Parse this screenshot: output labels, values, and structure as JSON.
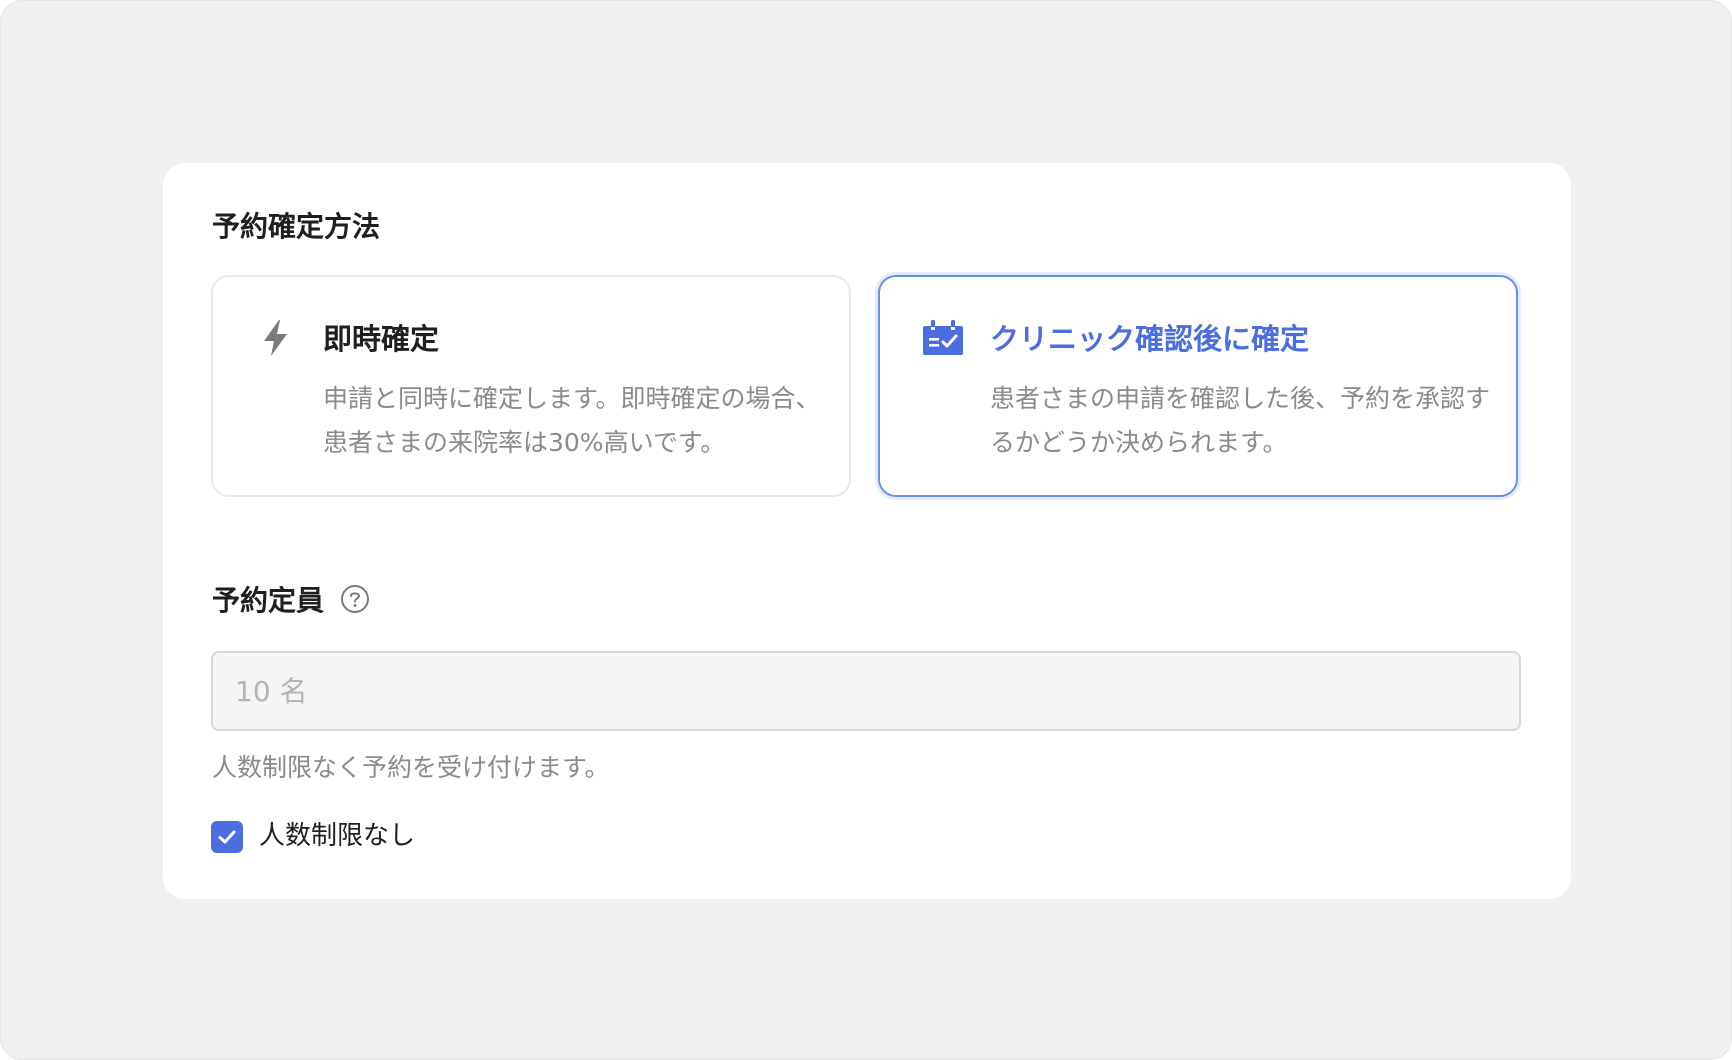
{
  "confirmation_method": {
    "heading": "予約確定方法",
    "options": [
      {
        "id": "instant",
        "title": "即時確定",
        "description": "申請と同時に確定します。即時確定の場合、患者さまの来院率は30%高いです。",
        "icon": "lightning-icon",
        "selected": false
      },
      {
        "id": "clinic-review",
        "title": "クリニック確認後に確定",
        "description": "患者さまの申請を確認した後、予約を承認するかどうか決められます。",
        "icon": "calendar-check-icon",
        "selected": true
      }
    ]
  },
  "capacity": {
    "label": "予約定員",
    "help_icon": "help-circle-icon",
    "input_placeholder": "10 名",
    "hint": "人数制限なく予約を受け付けます。",
    "unlimited_checkbox_label": "人数制限なし",
    "unlimited_checked": true
  },
  "colors": {
    "accent": "#4a6ee0",
    "selected_border": "#6c8fe6",
    "muted_text": "#8a8a8a",
    "heading_text": "#1f1f1f",
    "page_background": "#f0f0f0"
  }
}
